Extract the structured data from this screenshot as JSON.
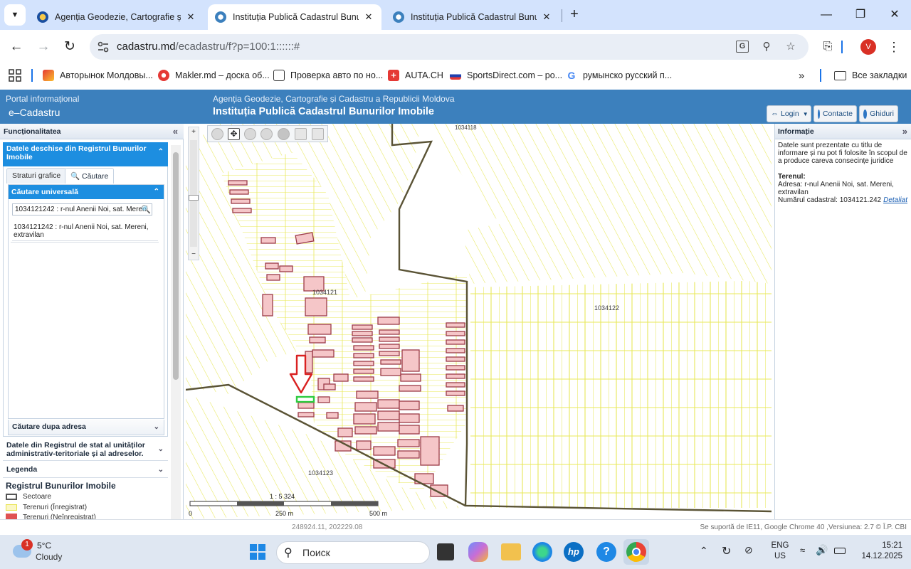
{
  "browser": {
    "tabs": [
      {
        "title": "Agenția Geodezie, Cartografie și C",
        "active": false
      },
      {
        "title": "Instituția Publică Cadastrul Bunuril",
        "active": true
      },
      {
        "title": "Instituția Publică Cadastrul Bunuril",
        "active": false
      }
    ],
    "url_host": "cadastru.md",
    "url_path": "/ecadastru/f?p=100:1::::::#",
    "profile_initial": "V",
    "bookmarks": [
      "Авторынок Молдовы...",
      "Makler.md – доска об...",
      "Проверка авто по но...",
      "AUTA.CH",
      "SportsDirect.com – ро...",
      "румынско русский п..."
    ],
    "all_bookmarks": "Все закладки"
  },
  "site": {
    "portal_label": "Portal informațional",
    "brand": "e–Cadastru",
    "agency": "Agenția Geodezie, Cartografie și Cadastru a Republicii Moldova",
    "institution": "Instituția Publică Cadastrul Bunurilor Imobile",
    "login": "Login",
    "contacts": "Contacte",
    "guides": "Ghiduri"
  },
  "left_panel": {
    "title": "Funcționalitatea",
    "open_section": "Datele deschise din Registrul Bunurilor Imobile",
    "tab_layers": "Straturi grafice",
    "tab_search": "Căutare",
    "search_header": "Căutare universală",
    "search_value": "1034121242 : r-nul Anenii Noi, sat. Mereni",
    "result_text": "1034121242 : r-nul Anenii Noi, sat. Mereni, extravilan",
    "address_search": "Căutare dupa adresa",
    "state_register": "Datele din Registrul de stat al unităților administrativ-teritoriale și al adreselor.",
    "legend": "Legenda",
    "legend_title": "Registrul Bunurilor Imobile",
    "legend_items": [
      "Sectoare",
      "Terenuri (Înregistrat)",
      "Terenuri (Neînregistrat)"
    ]
  },
  "map": {
    "labels": [
      "1034121",
      "1034122",
      "1034123",
      "1034118"
    ],
    "zoom_in": "+",
    "zoom_out": "−",
    "scale_ratio": "1 : 5 324",
    "scale_ticks": [
      "0",
      "250 m",
      "500 m"
    ]
  },
  "right_panel": {
    "title": "Informație",
    "disclaimer": "Datele sunt prezentate cu titlu de informare și nu pot fi folosite în scopul de a produce careva consecințe juridice",
    "teren_label": "Terenul:",
    "address": "Adresa: r-nul Anenii Noi, sat. Mereni, extravilan",
    "cad_number": "Numărul cadastral: 1034121.242",
    "details_link": "Detaliat"
  },
  "status": {
    "coords": "248924.11, 202229.08",
    "support": "Se suportă de IE11, Google Chrome 40 ,Versiunea: 2.7 © Î.P. CBI"
  },
  "taskbar": {
    "weather_badge": "1",
    "temperature": "5°C",
    "condition": "Cloudy",
    "search": "Поиск",
    "lang": "ENG",
    "region": "US",
    "time": "15:21",
    "date": "14.12.2025"
  }
}
